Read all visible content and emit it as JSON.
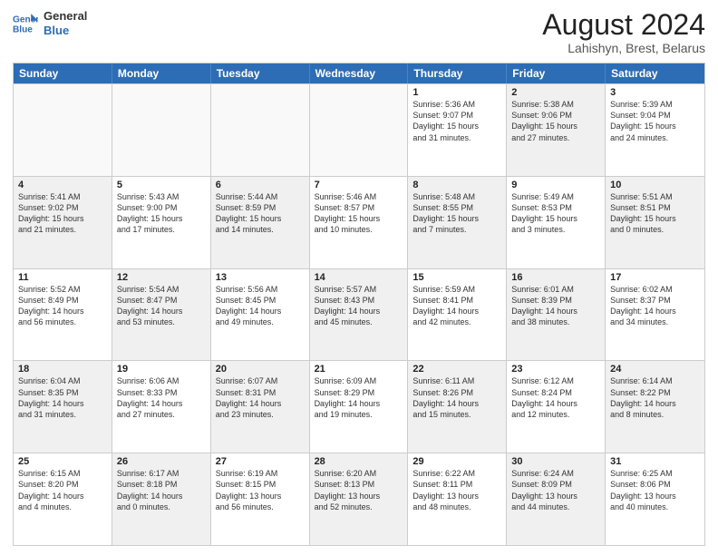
{
  "header": {
    "logo_line1": "General",
    "logo_line2": "Blue",
    "title": "August 2024",
    "subtitle": "Lahishyn, Brest, Belarus"
  },
  "days": [
    "Sunday",
    "Monday",
    "Tuesday",
    "Wednesday",
    "Thursday",
    "Friday",
    "Saturday"
  ],
  "rows": [
    [
      {
        "day": "",
        "empty": true
      },
      {
        "day": "",
        "empty": true
      },
      {
        "day": "",
        "empty": true
      },
      {
        "day": "",
        "empty": true
      },
      {
        "day": "1",
        "line1": "Sunrise: 5:36 AM",
        "line2": "Sunset: 9:07 PM",
        "line3": "Daylight: 15 hours",
        "line4": "and 31 minutes.",
        "shaded": false
      },
      {
        "day": "2",
        "line1": "Sunrise: 5:38 AM",
        "line2": "Sunset: 9:06 PM",
        "line3": "Daylight: 15 hours",
        "line4": "and 27 minutes.",
        "shaded": true
      },
      {
        "day": "3",
        "line1": "Sunrise: 5:39 AM",
        "line2": "Sunset: 9:04 PM",
        "line3": "Daylight: 15 hours",
        "line4": "and 24 minutes.",
        "shaded": false
      }
    ],
    [
      {
        "day": "4",
        "line1": "Sunrise: 5:41 AM",
        "line2": "Sunset: 9:02 PM",
        "line3": "Daylight: 15 hours",
        "line4": "and 21 minutes.",
        "shaded": true
      },
      {
        "day": "5",
        "line1": "Sunrise: 5:43 AM",
        "line2": "Sunset: 9:00 PM",
        "line3": "Daylight: 15 hours",
        "line4": "and 17 minutes.",
        "shaded": false
      },
      {
        "day": "6",
        "line1": "Sunrise: 5:44 AM",
        "line2": "Sunset: 8:59 PM",
        "line3": "Daylight: 15 hours",
        "line4": "and 14 minutes.",
        "shaded": true
      },
      {
        "day": "7",
        "line1": "Sunrise: 5:46 AM",
        "line2": "Sunset: 8:57 PM",
        "line3": "Daylight: 15 hours",
        "line4": "and 10 minutes.",
        "shaded": false
      },
      {
        "day": "8",
        "line1": "Sunrise: 5:48 AM",
        "line2": "Sunset: 8:55 PM",
        "line3": "Daylight: 15 hours",
        "line4": "and 7 minutes.",
        "shaded": true
      },
      {
        "day": "9",
        "line1": "Sunrise: 5:49 AM",
        "line2": "Sunset: 8:53 PM",
        "line3": "Daylight: 15 hours",
        "line4": "and 3 minutes.",
        "shaded": false
      },
      {
        "day": "10",
        "line1": "Sunrise: 5:51 AM",
        "line2": "Sunset: 8:51 PM",
        "line3": "Daylight: 15 hours",
        "line4": "and 0 minutes.",
        "shaded": true
      }
    ],
    [
      {
        "day": "11",
        "line1": "Sunrise: 5:52 AM",
        "line2": "Sunset: 8:49 PM",
        "line3": "Daylight: 14 hours",
        "line4": "and 56 minutes.",
        "shaded": false
      },
      {
        "day": "12",
        "line1": "Sunrise: 5:54 AM",
        "line2": "Sunset: 8:47 PM",
        "line3": "Daylight: 14 hours",
        "line4": "and 53 minutes.",
        "shaded": true
      },
      {
        "day": "13",
        "line1": "Sunrise: 5:56 AM",
        "line2": "Sunset: 8:45 PM",
        "line3": "Daylight: 14 hours",
        "line4": "and 49 minutes.",
        "shaded": false
      },
      {
        "day": "14",
        "line1": "Sunrise: 5:57 AM",
        "line2": "Sunset: 8:43 PM",
        "line3": "Daylight: 14 hours",
        "line4": "and 45 minutes.",
        "shaded": true
      },
      {
        "day": "15",
        "line1": "Sunrise: 5:59 AM",
        "line2": "Sunset: 8:41 PM",
        "line3": "Daylight: 14 hours",
        "line4": "and 42 minutes.",
        "shaded": false
      },
      {
        "day": "16",
        "line1": "Sunrise: 6:01 AM",
        "line2": "Sunset: 8:39 PM",
        "line3": "Daylight: 14 hours",
        "line4": "and 38 minutes.",
        "shaded": true
      },
      {
        "day": "17",
        "line1": "Sunrise: 6:02 AM",
        "line2": "Sunset: 8:37 PM",
        "line3": "Daylight: 14 hours",
        "line4": "and 34 minutes.",
        "shaded": false
      }
    ],
    [
      {
        "day": "18",
        "line1": "Sunrise: 6:04 AM",
        "line2": "Sunset: 8:35 PM",
        "line3": "Daylight: 14 hours",
        "line4": "and 31 minutes.",
        "shaded": true
      },
      {
        "day": "19",
        "line1": "Sunrise: 6:06 AM",
        "line2": "Sunset: 8:33 PM",
        "line3": "Daylight: 14 hours",
        "line4": "and 27 minutes.",
        "shaded": false
      },
      {
        "day": "20",
        "line1": "Sunrise: 6:07 AM",
        "line2": "Sunset: 8:31 PM",
        "line3": "Daylight: 14 hours",
        "line4": "and 23 minutes.",
        "shaded": true
      },
      {
        "day": "21",
        "line1": "Sunrise: 6:09 AM",
        "line2": "Sunset: 8:29 PM",
        "line3": "Daylight: 14 hours",
        "line4": "and 19 minutes.",
        "shaded": false
      },
      {
        "day": "22",
        "line1": "Sunrise: 6:11 AM",
        "line2": "Sunset: 8:26 PM",
        "line3": "Daylight: 14 hours",
        "line4": "and 15 minutes.",
        "shaded": true
      },
      {
        "day": "23",
        "line1": "Sunrise: 6:12 AM",
        "line2": "Sunset: 8:24 PM",
        "line3": "Daylight: 14 hours",
        "line4": "and 12 minutes.",
        "shaded": false
      },
      {
        "day": "24",
        "line1": "Sunrise: 6:14 AM",
        "line2": "Sunset: 8:22 PM",
        "line3": "Daylight: 14 hours",
        "line4": "and 8 minutes.",
        "shaded": true
      }
    ],
    [
      {
        "day": "25",
        "line1": "Sunrise: 6:15 AM",
        "line2": "Sunset: 8:20 PM",
        "line3": "Daylight: 14 hours",
        "line4": "and 4 minutes.",
        "shaded": false
      },
      {
        "day": "26",
        "line1": "Sunrise: 6:17 AM",
        "line2": "Sunset: 8:18 PM",
        "line3": "Daylight: 14 hours",
        "line4": "and 0 minutes.",
        "shaded": true
      },
      {
        "day": "27",
        "line1": "Sunrise: 6:19 AM",
        "line2": "Sunset: 8:15 PM",
        "line3": "Daylight: 13 hours",
        "line4": "and 56 minutes.",
        "shaded": false
      },
      {
        "day": "28",
        "line1": "Sunrise: 6:20 AM",
        "line2": "Sunset: 8:13 PM",
        "line3": "Daylight: 13 hours",
        "line4": "and 52 minutes.",
        "shaded": true
      },
      {
        "day": "29",
        "line1": "Sunrise: 6:22 AM",
        "line2": "Sunset: 8:11 PM",
        "line3": "Daylight: 13 hours",
        "line4": "and 48 minutes.",
        "shaded": false
      },
      {
        "day": "30",
        "line1": "Sunrise: 6:24 AM",
        "line2": "Sunset: 8:09 PM",
        "line3": "Daylight: 13 hours",
        "line4": "and 44 minutes.",
        "shaded": true
      },
      {
        "day": "31",
        "line1": "Sunrise: 6:25 AM",
        "line2": "Sunset: 8:06 PM",
        "line3": "Daylight: 13 hours",
        "line4": "and 40 minutes.",
        "shaded": false
      }
    ]
  ]
}
